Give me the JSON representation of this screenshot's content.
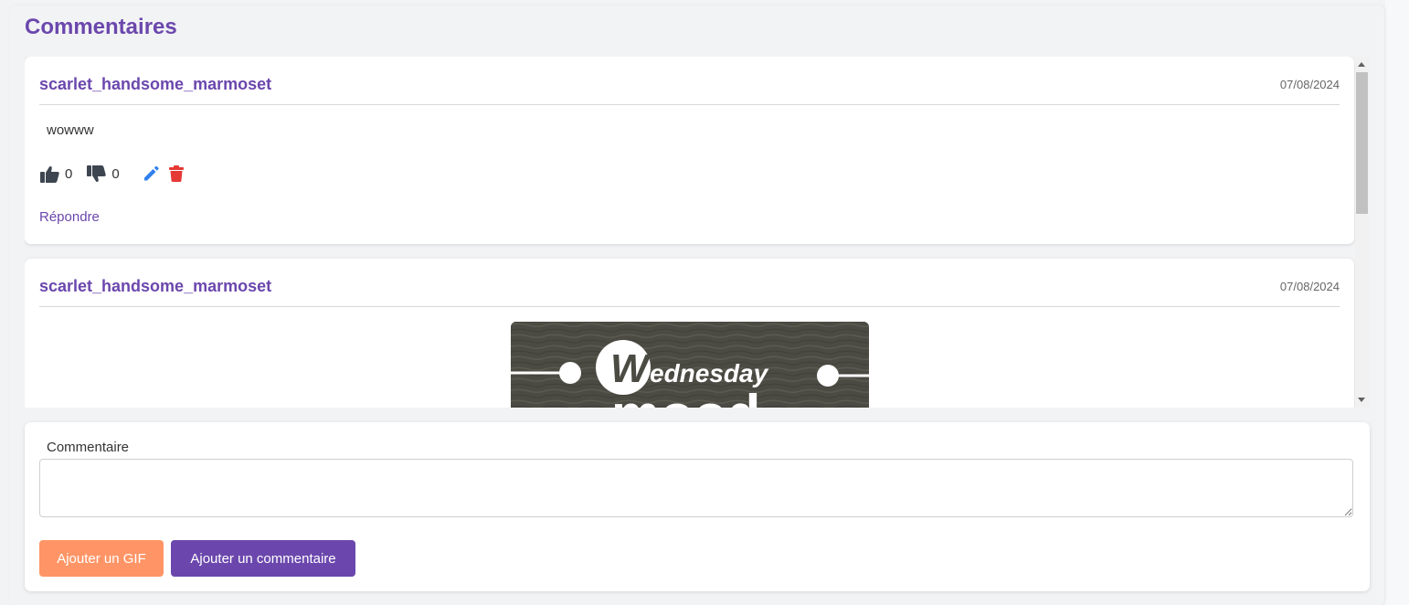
{
  "section": {
    "title": "Commentaires"
  },
  "comments": [
    {
      "author": "scarlet_handsome_marmoset",
      "date": "07/08/2024",
      "text": "wowww",
      "likes": "0",
      "dislikes": "0",
      "reply_label": "Répondre"
    },
    {
      "author": "scarlet_handsome_marmoset",
      "date": "07/08/2024",
      "gif_text": "ednesday",
      "gif_letter": "W",
      "gif_text2": "mood"
    }
  ],
  "form": {
    "label": "Commentaire",
    "textarea_value": "",
    "gif_button": "Ajouter un GIF",
    "submit_button": "Ajouter un commentaire"
  },
  "colors": {
    "accent": "#6b47ad",
    "gif_button": "#ff9566",
    "edit_icon": "#2f80ed",
    "delete_icon": "#e53935"
  },
  "icons": [
    "thumbs-up-icon",
    "thumbs-down-icon",
    "pencil-icon",
    "trash-icon"
  ]
}
